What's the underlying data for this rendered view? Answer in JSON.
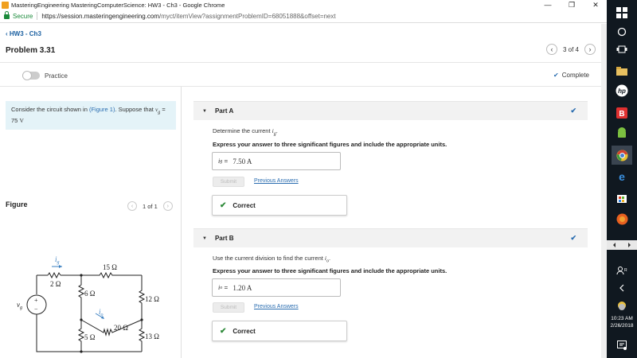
{
  "window": {
    "title": "MasteringEngineering MasteringComputerScience: HW3 - Ch3 - Google Chrome",
    "minimize": "—",
    "maximize": "❐",
    "close": "✕"
  },
  "address": {
    "secure_label": "Secure",
    "url_host": "https://session.masteringengineering.com",
    "url_path": "/myct/itemView?assignmentProblemID=68051888&offset=next"
  },
  "nav": {
    "back_label": "HW3 - Ch3",
    "problem_title": "Problem 3.31",
    "pager_text": "3 of 4",
    "prev": "‹",
    "next": "›"
  },
  "toolbar": {
    "practice_label": "Practice",
    "complete_label": "Complete",
    "complete_icon": "✔"
  },
  "intro": {
    "text_before": "Consider the circuit shown in ",
    "figure_link": "(Figure 1)",
    "text_mid": ". Suppose that ",
    "var": "v",
    "var_sub": "g",
    "text_eq": " = 75  ",
    "unit": "V"
  },
  "figure": {
    "heading": "Figure",
    "pager_text": "1 of 1",
    "labels": {
      "ig": "i",
      "ig_sub": "g",
      "io": "i",
      "io_sub": "o",
      "vg": "v",
      "vg_sub": "g",
      "r_top": "15 Ω",
      "r_2": "2 Ω",
      "r_6": "6 Ω",
      "r_12": "12 Ω",
      "r_20": "20 Ω",
      "r_5": "5 Ω",
      "r_13": "13 Ω",
      "plus": "+",
      "minus": "−"
    }
  },
  "partA": {
    "title": "Part A",
    "prompt_before": "Determine the current ",
    "prompt_var": "i",
    "prompt_sub": "g",
    "prompt_after": ".",
    "instructions": "Express your answer to three significant figures and include the appropriate units.",
    "answer_var": "i",
    "answer_sub": "g",
    "answer_eq": " = ",
    "answer_value": "7.50  A",
    "submit_label": "Submit",
    "prev_answers_label": "Previous Answers",
    "result_label": "Correct"
  },
  "partB": {
    "title": "Part B",
    "prompt_before": "Use the current division to find the current ",
    "prompt_var": "i",
    "prompt_sub": "o",
    "prompt_after": ".",
    "instructions": "Express your answer to three significant figures and include the appropriate units.",
    "answer_var": "i",
    "answer_sub": "o",
    "answer_eq": " = ",
    "answer_value": "1.20  A",
    "submit_label": "Submit",
    "prev_answers_label": "Previous Answers",
    "result_label": "Correct"
  },
  "taskbar": {
    "time": "10:23 AM",
    "date": "2/26/2018",
    "icons": [
      "start-icon",
      "search-icon",
      "task-view-icon",
      "file-explorer-icon",
      "hp-icon",
      "bluestacks-icon",
      "android-icon",
      "chrome-icon",
      "edge-icon",
      "store-icon",
      "firefox-icon",
      "people-icon",
      "chevron-left-icon",
      "weather-icon",
      "notifications-icon"
    ]
  }
}
